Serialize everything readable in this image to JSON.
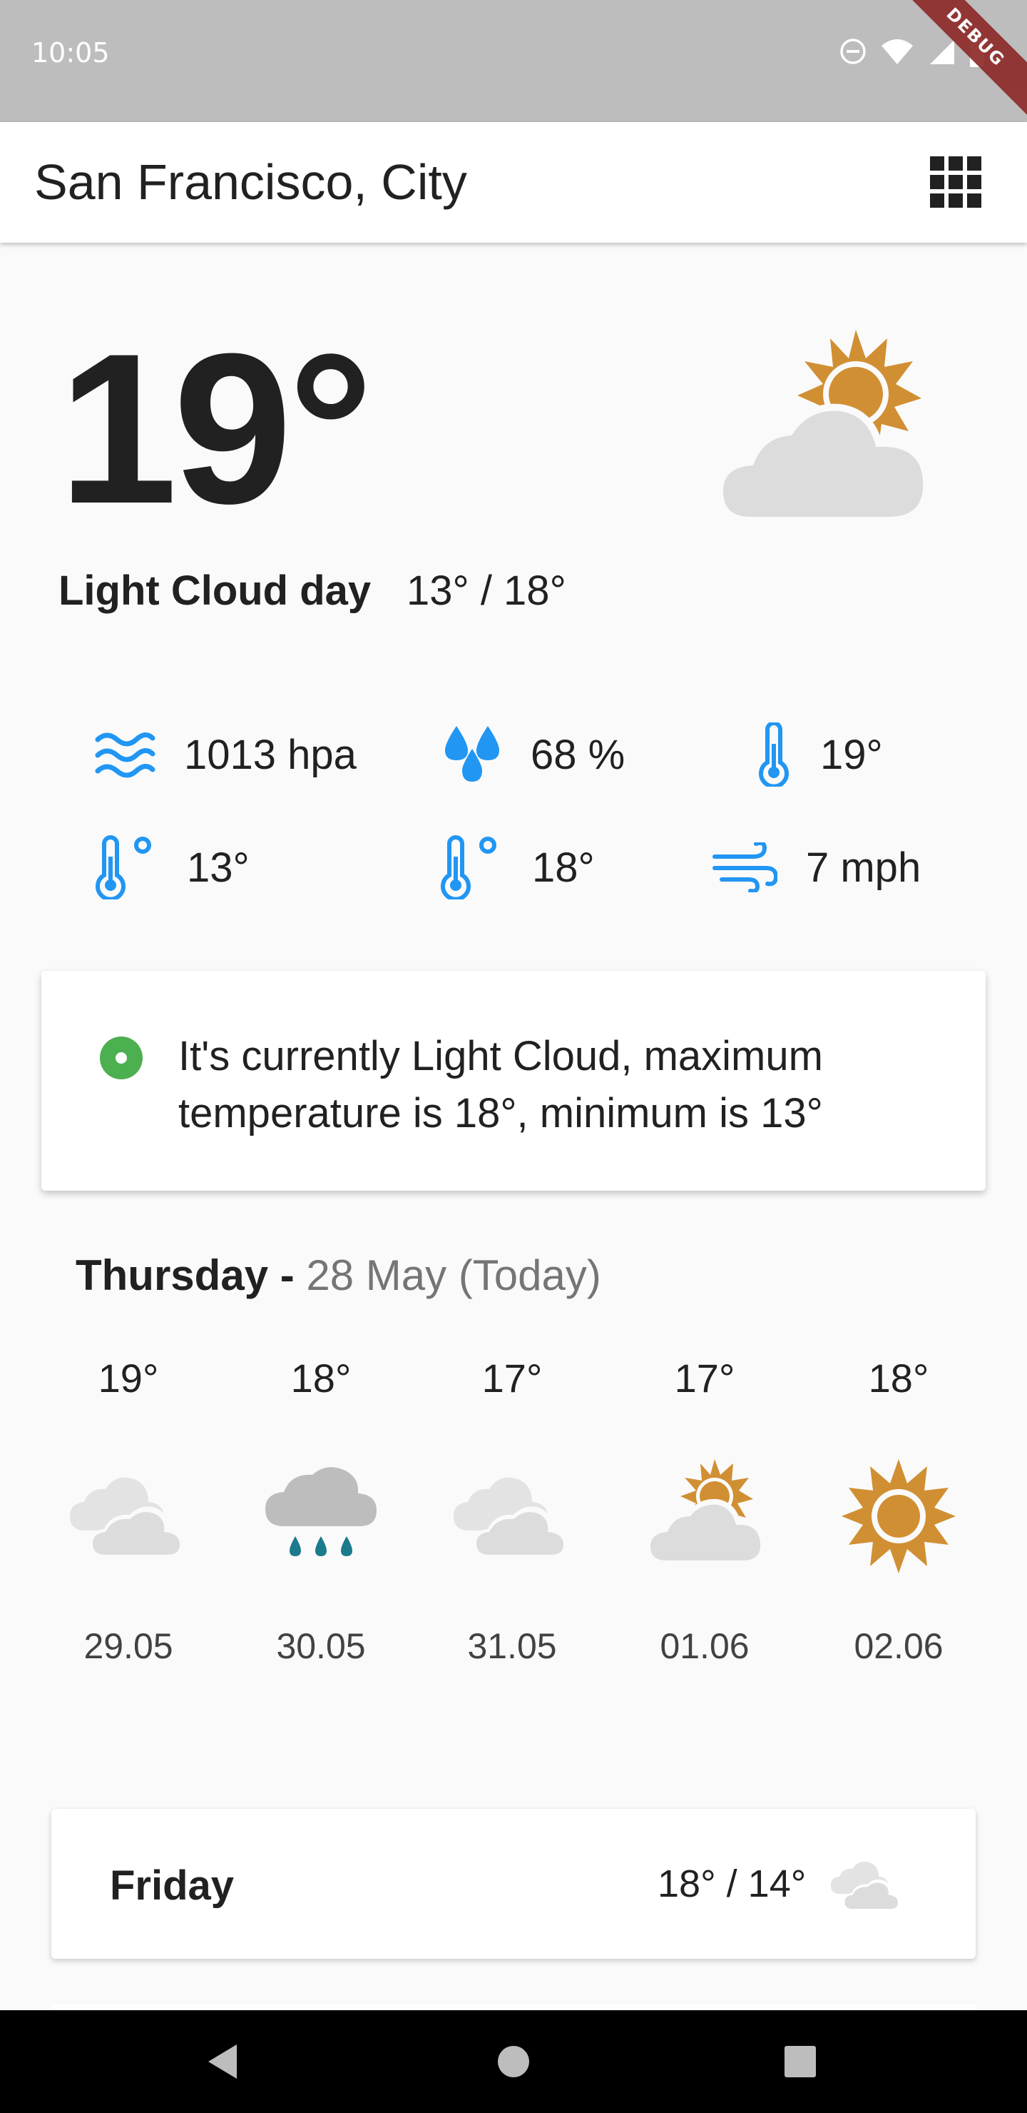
{
  "status_bar": {
    "time": "10:05",
    "debug_label": "DEBUG"
  },
  "app_bar": {
    "city": "San Francisco, City",
    "menu_icon": "grid-icon"
  },
  "current": {
    "temperature": "19°",
    "description": "Light Cloud day",
    "range": "13° / 18°",
    "icon": "partly-cloudy-sun-icon"
  },
  "stats": [
    {
      "icon": "pressure-icon",
      "value": "1013 hpa"
    },
    {
      "icon": "humidity-icon",
      "value": "68 %"
    },
    {
      "icon": "thermometer-icon",
      "value": "19°"
    },
    {
      "icon": "temp-min-icon",
      "value": "13°"
    },
    {
      "icon": "temp-max-icon",
      "value": "18°"
    },
    {
      "icon": "wind-icon",
      "value": "7 mph"
    }
  ],
  "info": {
    "text": "It's currently Light Cloud, maximum temperature is 18°, minimum is 13°"
  },
  "today": {
    "day": "Thursday",
    "separator": " - ",
    "date": "28 May (Today)"
  },
  "forecast": [
    {
      "temp": "19°",
      "icon": "heavy-cloud-icon",
      "date": "29.05"
    },
    {
      "temp": "18°",
      "icon": "light-rain-icon",
      "date": "30.05"
    },
    {
      "temp": "17°",
      "icon": "heavy-cloud-icon",
      "date": "31.05"
    },
    {
      "temp": "17°",
      "icon": "light-cloud-icon",
      "date": "01.06"
    },
    {
      "temp": "18°",
      "icon": "clear-sun-icon",
      "date": "02.06"
    }
  ],
  "days": [
    {
      "name": "Friday",
      "range": "18° / 14°",
      "icon": "heavy-cloud-icon"
    }
  ],
  "colors": {
    "accent_blue": "#2196f3",
    "sun": "#d18f33",
    "cloud": "#dcdcdc",
    "rain": "#1b7a8c",
    "info_green": "#4caf50"
  }
}
